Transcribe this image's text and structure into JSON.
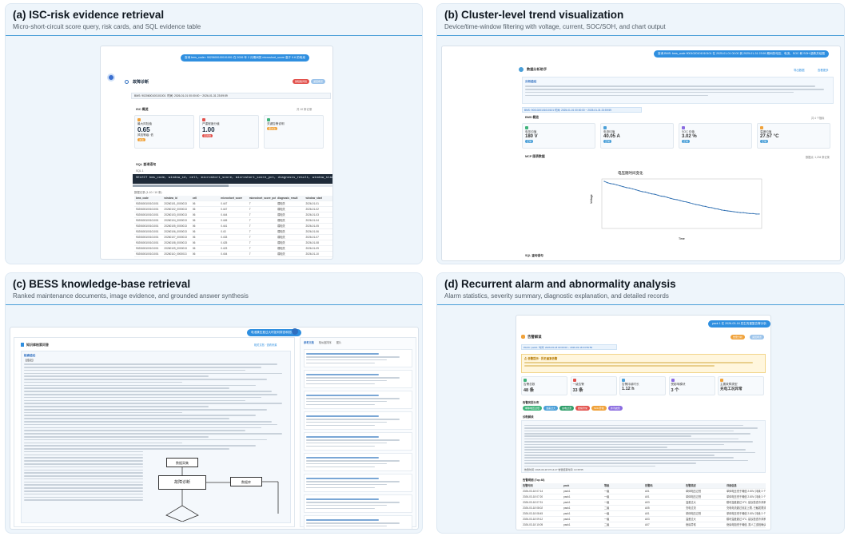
{
  "panels": {
    "a": {
      "title": "(a) ISC-risk evidence retrieval",
      "subtitle": "Micro-short-circuit score query, risk cards, and SQL evidence table",
      "query_pill": "查询 bms_code= 9020600100101001 在 2026 年 2 月期间的 microshort_score 高于 0.6 的电池",
      "header_title": "故障诊断",
      "header_tag_left": "微短路风险",
      "header_tag_right": "返回概览",
      "filter_bms": "BMS: 9020600100101001",
      "filter_time": "时间: 2026-01-01 00:00:00 ~ 2026-01-31 23:59:59",
      "section_isc": "ISC 概览",
      "section_isc_right": "共 10 条记录",
      "card1_label": "最大风险值",
      "card1_value": "0.65",
      "card1_note": "风险等级: 低",
      "card1_badge": "关注",
      "card2_label": "严重程度分值",
      "card2_value": "1.00",
      "card2_badge": "高风险",
      "card3_label": "关键告警说明",
      "card3_badge": "需关注",
      "section_sql": "SQL 查询语句",
      "sql_sub": "SQL 1",
      "sql_text": "SELECT bms_code, window_id, cell, microshort_score, microshort_score_pct, diagnosis_result, window_start, window_end",
      "table_caption": "数据记录 (1-10 / 10 条)",
      "table_headers": [
        "bms_code",
        "window_id",
        "cell",
        "microshort_score",
        "microshort_score_pct",
        "diagnosis_result",
        "window_start"
      ],
      "table_rows": [
        [
          "9020600100101001",
          "20260101_0000013",
          "06",
          "0.447",
          "7",
          "弱相关",
          "2026-01-01"
        ],
        [
          "9020600100101001",
          "20260102_0000013",
          "06",
          "0.447",
          "7",
          "弱相关",
          "2026-01-02"
        ],
        [
          "9020600100101001",
          "20260103_0000013",
          "06",
          "0.444",
          "7",
          "弱相关",
          "2026-01-03"
        ],
        [
          "9020600100101001",
          "20260104_0000013",
          "06",
          "0.445",
          "7",
          "弱相关",
          "2026-01-04"
        ],
        [
          "9020600100101001",
          "20260105_0000013",
          "06",
          "0.441",
          "7",
          "弱相关",
          "2026-01-05"
        ],
        [
          "9020600100101001",
          "20260106_0000013",
          "06",
          "0.43",
          "7",
          "弱相关",
          "2026-01-06"
        ],
        [
          "9020600100101001",
          "20260107_0000013",
          "06",
          "0.433",
          "7",
          "弱相关",
          "2026-01-07"
        ],
        [
          "9020600100101001",
          "20260108_0000013",
          "06",
          "0.425",
          "7",
          "弱相关",
          "2026-01-08"
        ],
        [
          "9020600100101001",
          "20260109_0000013",
          "06",
          "0.423",
          "7",
          "弱相关",
          "2026-01-09"
        ],
        [
          "9020600100101001",
          "20260110_0000013",
          "06",
          "0.404",
          "7",
          "弱相关",
          "2026-01-10"
        ]
      ]
    },
    "b": {
      "title": "(b) Cluster-level trend visualization",
      "subtitle": "Device/time-window filtering with voltage, current, SOC/SOH, and chart output",
      "query_pill": "查询 BMS: bms_code 9001020101010101 在 2025-01-01 00:00 到 2025-01-31 23:59 期间的电压、电流、SOC 和 SOH 趋势并绘图",
      "header_title": "数据分析助手",
      "header_right1": "导出数据",
      "header_right2": "查看更多",
      "summary_title": "分析结论",
      "filter_text": "BMS: 9001020101010101   时间: 2025-01-01 00:00:00 ~ 2025-01-31 23:59:59",
      "section_bms": "BMS 概览",
      "section_bms_right": "共 4 个指标",
      "metrics": [
        {
          "label": "电压均值",
          "value": "180",
          "unit": "V",
          "badge": "正常"
        },
        {
          "label": "电流均值",
          "value": "40.05",
          "unit": "A",
          "badge": "正常"
        },
        {
          "label": "SOC 均值",
          "value": "3.02",
          "unit": "%",
          "badge": "正常"
        },
        {
          "label": "温度均值",
          "value": "27.57",
          "unit": "°C",
          "badge": "正常"
        }
      ],
      "section_chart": "MCP 图表数据",
      "section_chart_right": "数据点: 1,234 条记录",
      "chart_title": "电压随时间变化",
      "chart_ylabel": "Voltage",
      "chart_xlabel": "Time",
      "section_sql": "SQL 查询语句"
    },
    "c": {
      "title": "(c) BESS knowledge-base retrieval",
      "subtitle": "Ranked maintenance documents, image evidence, and grounded answer synthesis",
      "query_pill": "电池簇压差过大时如何排查和处理？",
      "header_title": "知识库检索问答",
      "header_right": "相关文档 · 查看来源",
      "answer_title": "检索结论",
      "answer_intro": "【结论】",
      "diagram_box1": "数据采集",
      "diagram_box2": "故障诊断",
      "diagram_box3": "数据库",
      "ref_tab1": "参考文档",
      "ref_tab2": "相似度排序",
      "ref_tab3": "图片"
    },
    "d": {
      "title": "(d) Recurrent alarm and abnormality analysis",
      "subtitle": "Alarm statistics, severity summary, diagnostic explanation, and detailed records",
      "query_pill": "pack 1 在 2026-03-18 发生的重复告警分析",
      "header_title": "告警解读",
      "header_tag1": "告警分析",
      "header_tag2": "返回概览",
      "filter_pack": "PACK: pack1",
      "filter_time": "时间: 2026-03-18 00:00:00 ~ 2026-03-18 23:59:59",
      "warn_title": "⚠ 告警提示 · 历史重复告警",
      "stats": [
        {
          "label": "告警总数",
          "value": "48",
          "unit": "条"
        },
        {
          "label": "一级告警",
          "value": "33",
          "unit": "条"
        },
        {
          "label": "告警持续时长",
          "value": "1.12",
          "unit": "h"
        },
        {
          "label": "受影响模块",
          "value": "3",
          "unit": "个"
        },
        {
          "label": "主要故障类型",
          "value": "充电工况异常",
          "unit": ""
        }
      ],
      "type_chips_label": "告警类型分布",
      "chips": [
        "单体电压过低",
        "温差过大",
        "充电过流",
        "绝缘异常",
        "SOC异常",
        "通讯故障"
      ],
      "explain_title": "诊断解读",
      "explain_footer": "告警时间: 2026-03-18 07:14:27   告警结束时间: 13:35:55",
      "table_title": "告警明细 (Top 48)",
      "table_headers": [
        "告警时间",
        "pack",
        "等级",
        "告警码",
        "告警描述",
        "详细信息"
      ],
      "table_rows": [
        [
          "2026-03-18 07:14",
          "pack1",
          "一级",
          "A01",
          "单体电压过低",
          "单体电压低于阈值 2.80V, 持续 3 个周期"
        ],
        [
          "2026-03-18 07:20",
          "pack1",
          "一级",
          "A01",
          "单体电压过低",
          "单体电压低于阈值 2.80V, 持续 3 个周期"
        ],
        [
          "2026-03-18 07:31",
          "pack1",
          "一级",
          "A03",
          "温差过大",
          "模块温差超过 8°C, 建议检查冷却系统"
        ],
        [
          "2026-03-18 08:02",
          "pack1",
          "二级",
          "A05",
          "充电过流",
          "充电电流超过设定上限, 已触发限流"
        ],
        [
          "2026-03-18 08:45",
          "pack1",
          "一级",
          "A01",
          "单体电压过低",
          "单体电压低于阈值 2.80V, 持续 3 个周期"
        ],
        [
          "2026-03-18 09:12",
          "pack1",
          "一级",
          "A03",
          "温差过大",
          "模块温差超过 8°C, 建议检查冷却系统"
        ],
        [
          "2026-03-18 10:05",
          "pack1",
          "二级",
          "A07",
          "绝缘异常",
          "绝缘电阻低于阈值, 需人工巡检确认"
        ]
      ]
    }
  },
  "colors": {
    "accent": "#2f8fe0",
    "panel_bg": "#eef5fb",
    "divider": "#4a9fd8",
    "red": "#e2514c",
    "orange": "#f0a23a",
    "green": "#3fb37a",
    "chart_line": "#2b6cb0"
  },
  "chart_data": {
    "type": "line",
    "title": "电压随时间变化",
    "xlabel": "Time",
    "ylabel": "Voltage",
    "series": [
      {
        "values": [
          1.0,
          0.97,
          0.95,
          0.94,
          0.92,
          0.9,
          0.88,
          0.86,
          0.85,
          0.83,
          0.81,
          0.79,
          0.77,
          0.76,
          0.74,
          0.72,
          0.71,
          0.69,
          0.67,
          0.66,
          0.64,
          0.62,
          0.6,
          0.59,
          0.57,
          0.55,
          0.54,
          0.52,
          0.5,
          0.48,
          0.47,
          0.45,
          0.44,
          0.42,
          0.41,
          0.39,
          0.38,
          0.36,
          0.35,
          0.34,
          0.33,
          0.32,
          0.31,
          0.3,
          0.3,
          0.29,
          0.28,
          0.28,
          0.27,
          0.27
        ]
      }
    ]
  }
}
